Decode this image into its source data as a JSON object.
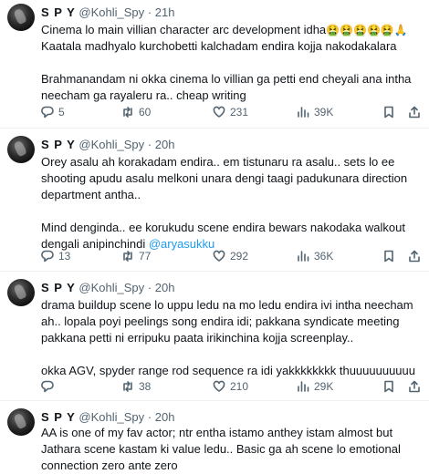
{
  "tweets": [
    {
      "name": "S P Y",
      "handle": "@Kohli_Spy",
      "time": "21h",
      "line1": "Cinema lo main villian character arc development idha",
      "emojis": "🤮🤮🤮🤮🤮🙏",
      "rest": "Kaatala madhyalo kurchobetti kalchadam endira kojja nakodakalara\n\nBrahmanandam ni okka cinema lo villian ga petti end cheyali ana intha neecham ga rayaleru ra.. cheap writing",
      "replies": "5",
      "retweets": "60",
      "likes": "231",
      "views": "39K"
    },
    {
      "name": "S P Y",
      "handle": "@Kohli_Spy",
      "time": "20h",
      "text": "Orey asalu ah korakadam endira.. em tistunaru ra asalu.. sets lo ee shooting apudu asalu melkoni unara dengi taagi padukunara direction department antha..\n\nMind denginda.. ee korukudu scene endira bewars nakodaka walkout dengali anipinchindi ",
      "mention": "@aryasukku",
      "replies": "13",
      "retweets": "77",
      "likes": "292",
      "views": "36K"
    },
    {
      "name": "S P Y",
      "handle": "@Kohli_Spy",
      "time": "20h",
      "text": "drama buildup scene lo uppu ledu na mo ledu endira ivi intha neecham ah.. lopala poyi peelings song endira idi; pakkana syndicate meeting pakkana petti ni erripuku paata irikinchina kojja screenplay..\n\nokka AGV, spyder range rod sequence ra idi yakkkkkkkk thuuuuuuuuuu",
      "replies": "",
      "retweets": "38",
      "likes": "210",
      "views": "29K"
    },
    {
      "name": "S P Y",
      "handle": "@Kohli_Spy",
      "time": "20h",
      "text": "AA is one of my fav actor; ntr entha istamo anthey istam almost but Jathara scene kastam ki value ledu.. Basic ga ah scene lo emotional connection zero ante zero"
    }
  ],
  "separator": "·",
  "icons": [
    "reply-icon",
    "retweet-icon",
    "like-icon",
    "views-icon",
    "bookmark-icon",
    "share-icon"
  ]
}
